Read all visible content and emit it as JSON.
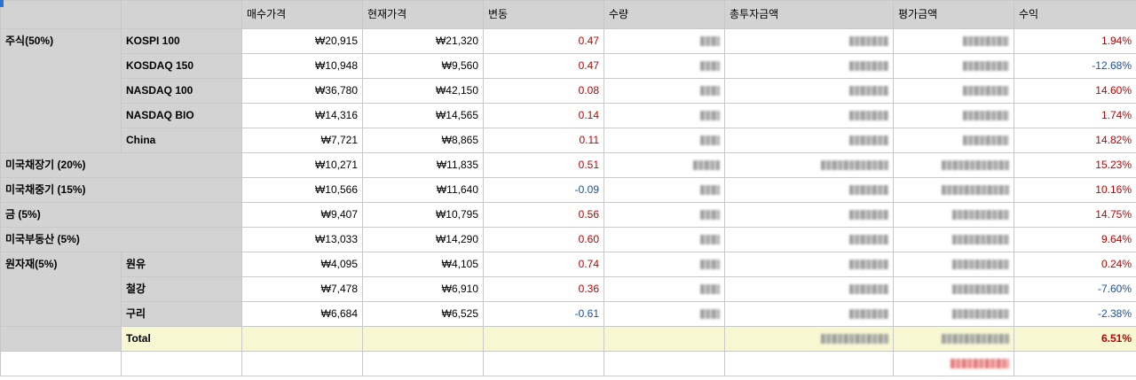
{
  "header": {
    "blank_a": "",
    "blank_b": "",
    "buy_price": "매수가격",
    "cur_price": "현재가격",
    "change": "변동",
    "qty": "수량",
    "total_invest": "총투자금액",
    "eval_amount": "평가금액",
    "return": "수익"
  },
  "groups": {
    "stocks": "주식(50%)",
    "us_long": "미국채장기 (20%)",
    "us_mid": "미국채중기 (15%)",
    "gold": "금 (5%)",
    "us_realestate": "미국부동산 (5%)",
    "commodities": "원자재(5%)"
  },
  "rows": [
    {
      "name": "KOSPI 100",
      "buy": "₩20,915",
      "cur": "₩21,320",
      "change": "0.47",
      "change_sign": "pos",
      "ret": "1.94%",
      "ret_sign": "pos"
    },
    {
      "name": "KOSDAQ 150",
      "buy": "₩10,948",
      "cur": "₩9,560",
      "change": "0.47",
      "change_sign": "pos",
      "ret": "-12.68%",
      "ret_sign": "neg"
    },
    {
      "name": "NASDAQ 100",
      "buy": "₩36,780",
      "cur": "₩42,150",
      "change": "0.08",
      "change_sign": "pos",
      "ret": "14.60%",
      "ret_sign": "pos"
    },
    {
      "name": "NASDAQ BIO",
      "buy": "₩14,316",
      "cur": "₩14,565",
      "change": "0.14",
      "change_sign": "pos",
      "ret": "1.74%",
      "ret_sign": "pos"
    },
    {
      "name": "China",
      "buy": "₩7,721",
      "cur": "₩8,865",
      "change": "0.11",
      "change_sign": "pos",
      "ret": "14.82%",
      "ret_sign": "pos"
    },
    {
      "name": "",
      "buy": "₩10,271",
      "cur": "₩11,835",
      "change": "0.51",
      "change_sign": "pos",
      "ret": "15.23%",
      "ret_sign": "pos"
    },
    {
      "name": "",
      "buy": "₩10,566",
      "cur": "₩11,640",
      "change": "-0.09",
      "change_sign": "neg",
      "ret": "10.16%",
      "ret_sign": "pos"
    },
    {
      "name": "",
      "buy": "₩9,407",
      "cur": "₩10,795",
      "change": "0.56",
      "change_sign": "pos",
      "ret": "14.75%",
      "ret_sign": "pos"
    },
    {
      "name": "",
      "buy": "₩13,033",
      "cur": "₩14,290",
      "change": "0.60",
      "change_sign": "pos",
      "ret": "9.64%",
      "ret_sign": "pos"
    },
    {
      "name": "원유",
      "buy": "₩4,095",
      "cur": "₩4,105",
      "change": "0.74",
      "change_sign": "pos",
      "ret": "0.24%",
      "ret_sign": "pos"
    },
    {
      "name": "철강",
      "buy": "₩7,478",
      "cur": "₩6,910",
      "change": "0.36",
      "change_sign": "pos",
      "ret": "-7.60%",
      "ret_sign": "neg"
    },
    {
      "name": "구리",
      "buy": "₩6,684",
      "cur": "₩6,525",
      "change": "-0.61",
      "change_sign": "neg",
      "ret": "-2.38%",
      "ret_sign": "neg"
    }
  ],
  "total": {
    "label": "Total",
    "ret": "6.51%"
  },
  "colors": {
    "positive": "#c00000",
    "negative": "#1f4e9e",
    "header_bg": "#d3d3d3",
    "total_bg": "#f7f8d2"
  }
}
